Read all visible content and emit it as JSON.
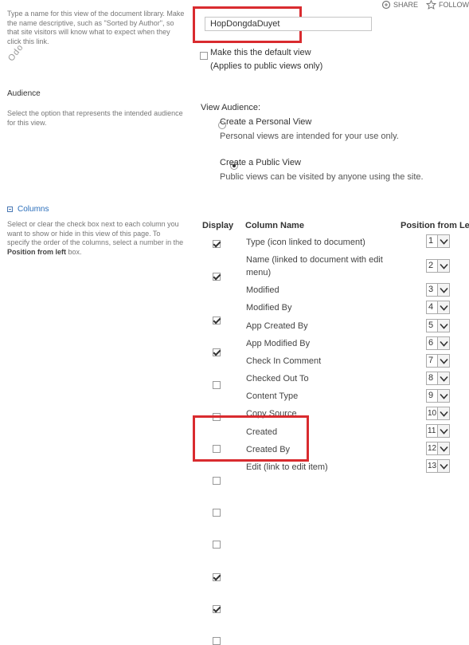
{
  "top_actions": {
    "share_label": "SHARE",
    "follow_label": "FOLLOW"
  },
  "name_section": {
    "description": [
      "Type a name for this view of the document library. Make",
      "the name descriptive, such as \"Sorted by Author\", so",
      "that site visitors will know what to expect when they",
      "click this link."
    ],
    "view_name_value": "HopDongdaDuyet",
    "default_view_label": "Make this the default view",
    "default_view_note": "(Applies to public views only)",
    "default_view_checked": false
  },
  "watermark": "Odo",
  "audience": {
    "title": "Audience",
    "description": [
      "Select the option that represents the intended audience",
      "for this view."
    ],
    "view_audience_label": "View Audience:",
    "personal_label": "Create a Personal View",
    "personal_note": "Personal views are intended for your use only.",
    "public_label": "Create a Public View",
    "public_note": "Public views can be visited by anyone using the site.",
    "selected": "public"
  },
  "columns": {
    "title": "Columns",
    "description_lines": [
      "Select or clear the check box next to each column you",
      "want to show or hide in this view of this page. To",
      "specify the order of the columns, select a number in the"
    ],
    "description_last_bold": "Position from left",
    "description_last_rest": " box.",
    "headers": {
      "display": "Display",
      "column_name": "Column Name",
      "position": "Position from Left"
    },
    "rows": [
      {
        "name": "Type (icon linked to document)",
        "checked": true,
        "position": "1"
      },
      {
        "name": "Name (linked to document with edit",
        "name2": "menu)",
        "checked": true,
        "position": "2"
      },
      {
        "name": "Modified",
        "checked": true,
        "position": "3"
      },
      {
        "name": "Modified By",
        "checked": true,
        "position": "4"
      },
      {
        "name": "App Created By",
        "checked": false,
        "position": "5"
      },
      {
        "name": "App Modified By",
        "checked": false,
        "position": "6"
      },
      {
        "name": "Check In Comment",
        "checked": false,
        "position": "7"
      },
      {
        "name": "Checked Out To",
        "checked": false,
        "position": "8"
      },
      {
        "name": "Content Type",
        "checked": false,
        "position": "9"
      },
      {
        "name": "Copy Source",
        "checked": false,
        "position": "10"
      },
      {
        "name": "Created",
        "checked": true,
        "position": "11"
      },
      {
        "name": "Created By",
        "checked": true,
        "position": "12"
      },
      {
        "name": "Edit (link to edit item)",
        "checked": false,
        "position": "13"
      }
    ]
  },
  "colors": {
    "highlight": "#d92b2f",
    "link": "#2a6ebb"
  }
}
